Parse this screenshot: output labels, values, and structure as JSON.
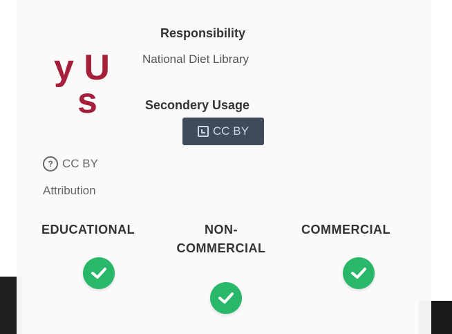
{
  "background_heading": {
    "line1": "y Use",
    "line2": "s"
  },
  "responsibility": {
    "label": "Responsibility",
    "value": "National Diet Library"
  },
  "secondary_usage": {
    "label": "Secondery Usage",
    "badge": "CC BY"
  },
  "license": {
    "name": "CC BY",
    "description": "Attribution"
  },
  "usage_types": [
    {
      "line1": "EDUCATIONAL",
      "line2": ""
    },
    {
      "line1": "NON-",
      "line2": "COMMERCIAL"
    },
    {
      "line1": "COMMERCIAL",
      "line2": ""
    }
  ],
  "colors": {
    "heading": "#a5203a",
    "check": "#29b86a",
    "badge": "#3f4b5d"
  }
}
